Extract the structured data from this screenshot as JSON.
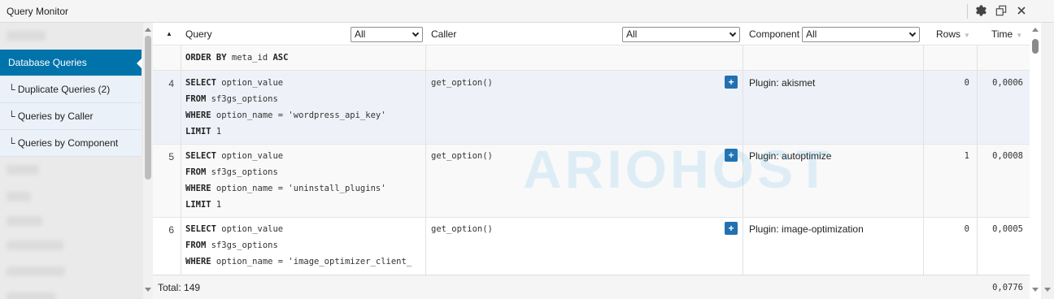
{
  "window": {
    "title": "Query Monitor",
    "icons": [
      "gear-icon",
      "popout-icon",
      "close-icon"
    ]
  },
  "sidebar": {
    "items": [
      {
        "label": "Database Queries",
        "active": true
      },
      {
        "label": "└ Duplicate Queries (2)"
      },
      {
        "label": "└ Queries by Caller"
      },
      {
        "label": "└ Queries by Component"
      }
    ]
  },
  "table": {
    "headers": {
      "query": "Query",
      "query_filter": "All",
      "caller": "Caller",
      "caller_filter": "All",
      "component": "Component",
      "component_filter": "All",
      "rows": "Rows",
      "time": "Time"
    },
    "partial_row": {
      "line_kw": "ORDER BY",
      "line_rest": " meta_id ",
      "line_kw2": "ASC"
    },
    "rows": [
      {
        "num": "4",
        "q1_kw": "SELECT",
        "q1": " option_value",
        "q2_kw": "FROM",
        "q2": " sf3gs_options",
        "q3_kw": "WHERE",
        "q3": " option_name = 'wordpress_api_key'",
        "q4_kw": "LIMIT",
        "q4": " 1",
        "caller": "get_option()",
        "component": "Plugin: akismet",
        "rows": "0",
        "time": "0,0006"
      },
      {
        "num": "5",
        "q1_kw": "SELECT",
        "q1": " option_value",
        "q2_kw": "FROM",
        "q2": " sf3gs_options",
        "q3_kw": "WHERE",
        "q3": " option_name = 'uninstall_plugins'",
        "q4_kw": "LIMIT",
        "q4": " 1",
        "caller": "get_option()",
        "component": "Plugin: autoptimize",
        "rows": "1",
        "time": "0,0008"
      },
      {
        "num": "6",
        "q1_kw": "SELECT",
        "q1": " option_value",
        "q2_kw": "FROM",
        "q2": " sf3gs_options",
        "q3_kw": "WHERE",
        "q3": " option_name = 'image_optimizer_client_",
        "caller": "get_option()",
        "component": "Plugin: image-optimization",
        "rows": "0",
        "time": "0,0005"
      }
    ],
    "footer": {
      "total": "Total: 149",
      "time": "0,0776"
    }
  },
  "watermark": "ARIOHOST",
  "colors": {
    "accent": "#0073aa",
    "button": "#2271b1",
    "highlight_row": "#eef2f8",
    "watermark": "#2ea3dc"
  }
}
